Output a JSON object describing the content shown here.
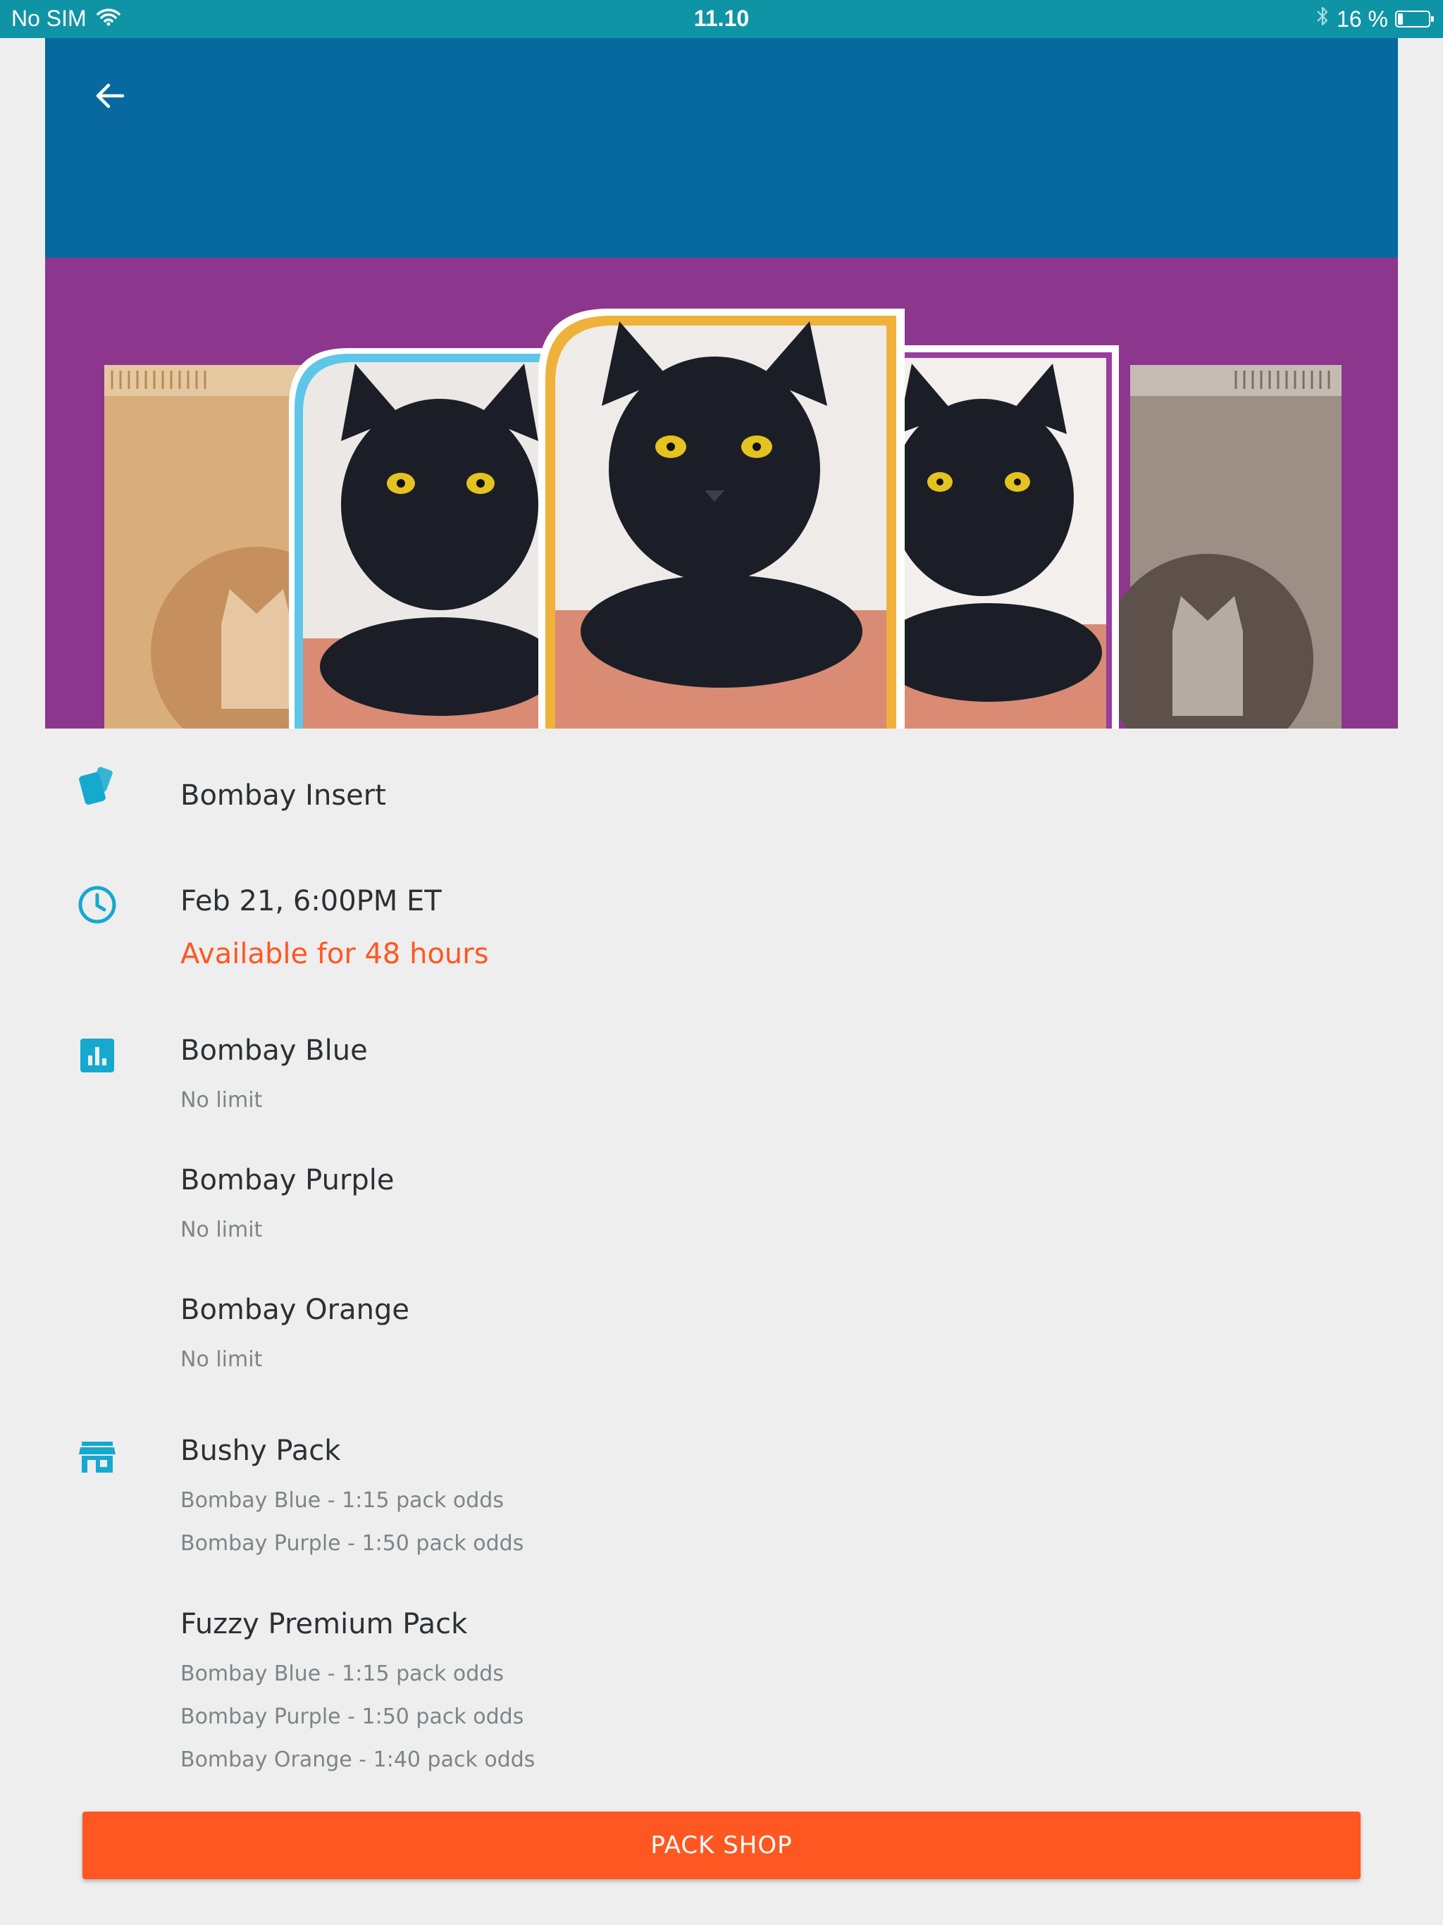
{
  "status_bar": {
    "carrier": "No SIM",
    "time": "11.10",
    "battery_text": "16 %",
    "battery_level": 0.16
  },
  "header": {
    "back_icon": "arrow-left-icon",
    "color": "#0769a0"
  },
  "hero": {
    "background_color": "#8d368e",
    "pack_colors": [
      "#d9ae7c",
      "#9b8f86"
    ],
    "card_frame_colors": [
      "#5ec6e8",
      "#f0b13a",
      "#9b3da0"
    ]
  },
  "details": {
    "set": {
      "icon": "cards-icon",
      "title": "Bombay Insert"
    },
    "release": {
      "icon": "clock-icon",
      "date": "Feb 21, 6:00PM ET",
      "availability": "Available for 48 hours"
    },
    "variants": {
      "icon": "bar-chart-icon",
      "items": [
        {
          "name": "Bombay Blue",
          "limit": "No limit"
        },
        {
          "name": "Bombay Purple",
          "limit": "No limit"
        },
        {
          "name": "Bombay Orange",
          "limit": "No limit"
        }
      ]
    },
    "packs": {
      "icon": "store-icon",
      "items": [
        {
          "name": "Bushy Pack",
          "odds": [
            "Bombay Blue - 1:15 pack odds",
            "Bombay Purple - 1:50 pack odds"
          ]
        },
        {
          "name": "Fuzzy Premium Pack",
          "odds": [
            "Bombay Blue - 1:15 pack odds",
            "Bombay Purple - 1:50 pack odds",
            "Bombay Orange - 1:40 pack odds"
          ]
        }
      ]
    }
  },
  "cta": {
    "label": "PACK SHOP",
    "color": "#ff5722"
  },
  "colors": {
    "status_bar": "#0f94a6",
    "icon_accent": "#16a9cf",
    "background": "#eeeeee"
  }
}
